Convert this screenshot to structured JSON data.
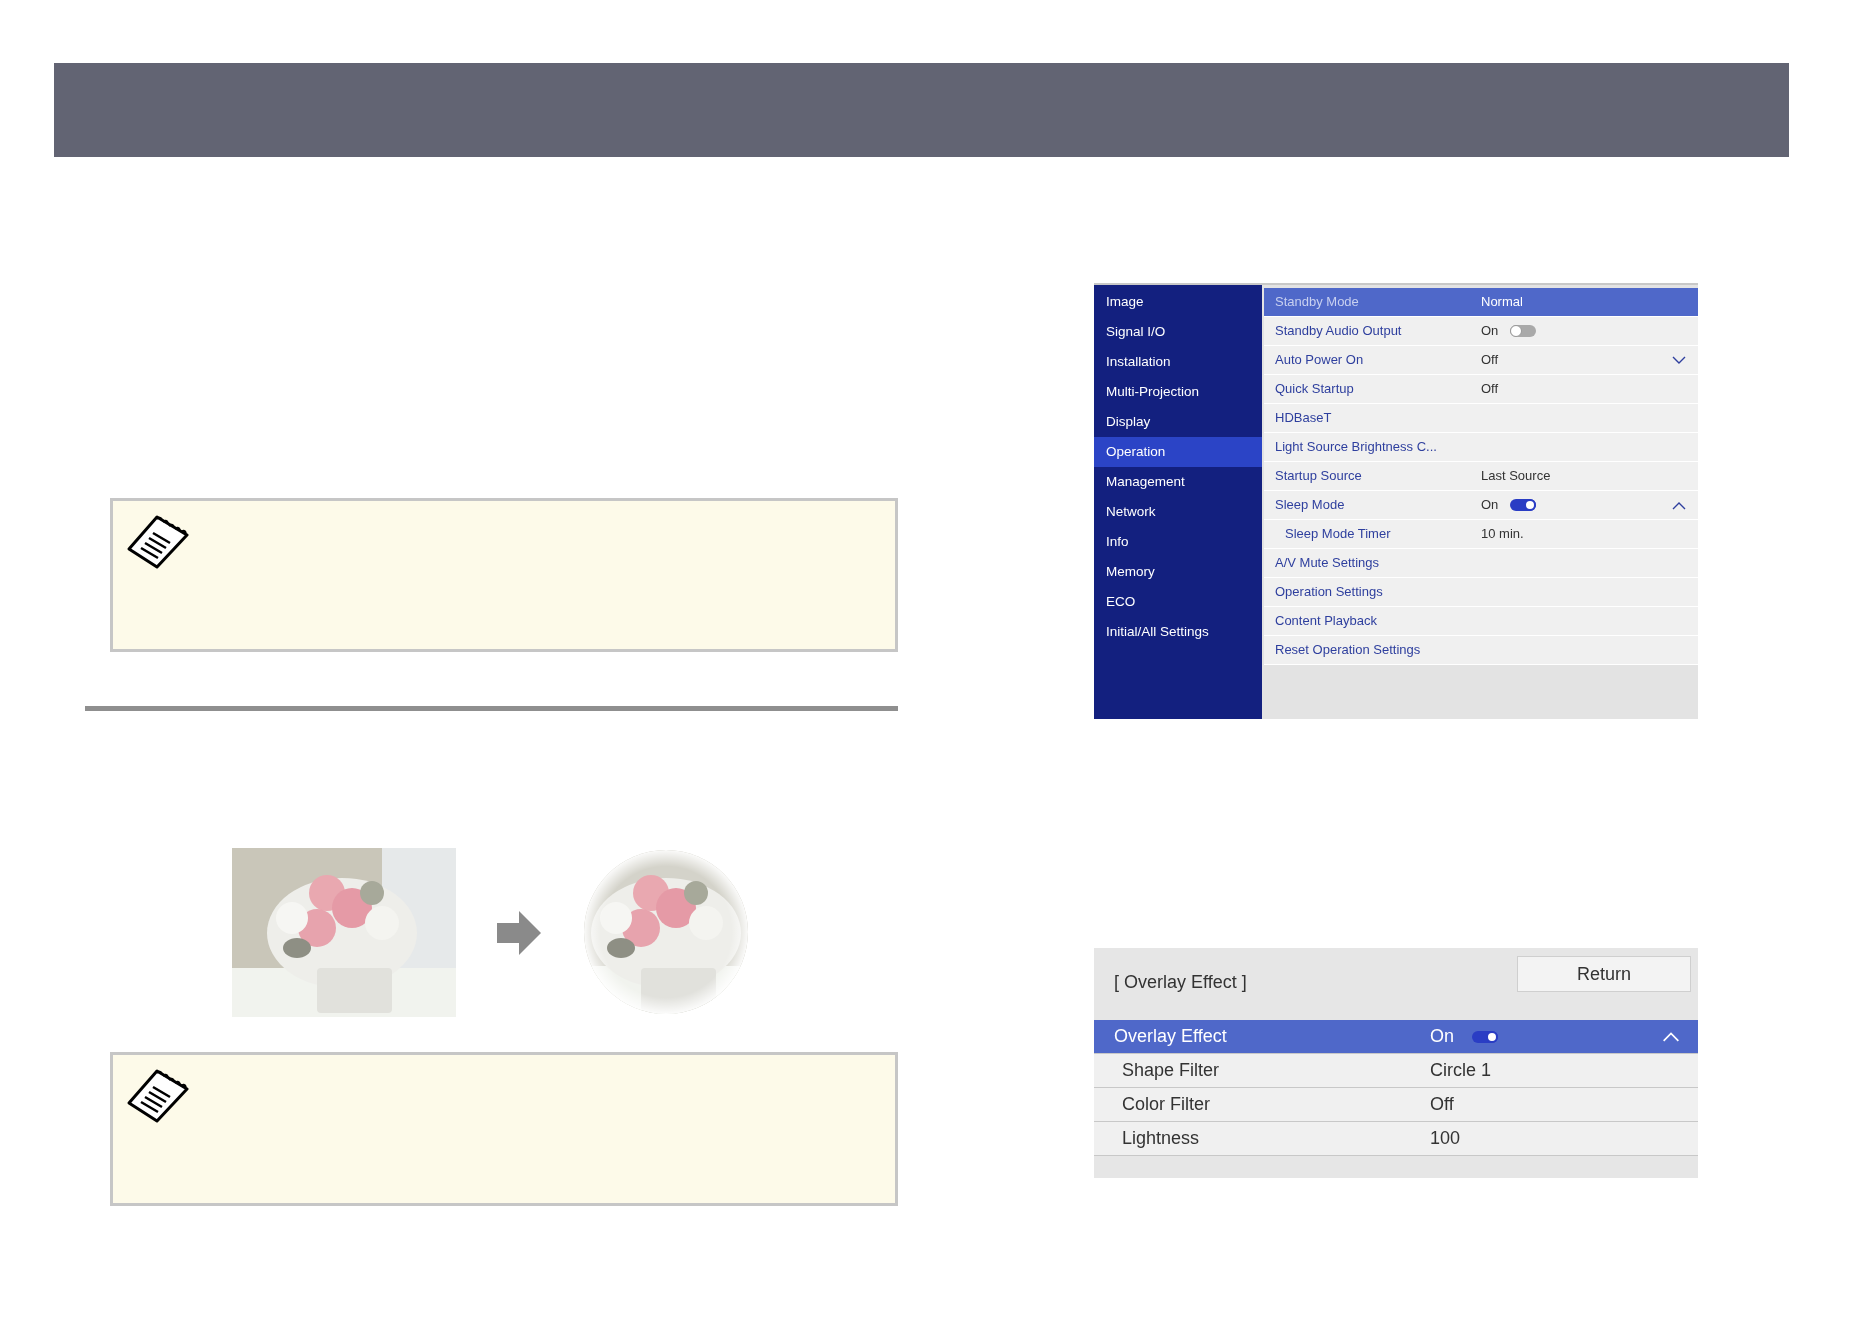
{
  "menu": {
    "categories": [
      {
        "label": "Image",
        "selected": false
      },
      {
        "label": "Signal I/O",
        "selected": false
      },
      {
        "label": "Installation",
        "selected": false
      },
      {
        "label": "Multi-Projection",
        "selected": false
      },
      {
        "label": "Display",
        "selected": false
      },
      {
        "label": "Operation",
        "selected": true
      },
      {
        "label": "Management",
        "selected": false
      },
      {
        "label": "Network",
        "selected": false
      },
      {
        "label": "Info",
        "selected": false
      },
      {
        "label": "Memory",
        "selected": false
      },
      {
        "label": "ECO",
        "selected": false
      },
      {
        "label": "Initial/All Settings",
        "selected": false
      }
    ],
    "rows": [
      {
        "label": "Standby Mode",
        "value": "Normal",
        "selected": true
      },
      {
        "label": "Standby Audio Output",
        "value": "On",
        "kind": "toggle",
        "on": false,
        "selected": false
      },
      {
        "label": "Auto Power On",
        "value": "Off",
        "expanded": false,
        "selected": false
      },
      {
        "label": "Quick Startup",
        "value": "Off",
        "selected": false
      },
      {
        "label": "HDBaseT",
        "selected": false
      },
      {
        "label": "Light Source Brightness C...",
        "selected": false
      },
      {
        "label": "Startup Source",
        "value": "Last Source",
        "selected": false
      },
      {
        "label": "Sleep Mode",
        "value": "On",
        "kind": "toggle",
        "on": true,
        "expanded": true,
        "selected": false,
        "children": [
          {
            "label": "Sleep Mode Timer",
            "value": "10 min.",
            "selected": false
          }
        ]
      },
      {
        "label": "A/V Mute Settings",
        "selected": false
      },
      {
        "label": "Operation Settings",
        "selected": false
      },
      {
        "label": "Content Playback",
        "selected": false
      },
      {
        "label": "Reset Operation Settings",
        "selected": false
      }
    ]
  },
  "overlay_menu": {
    "title": "[ Overlay Effect ]",
    "return_button": "Return",
    "rows": [
      {
        "label": "Overlay Effect",
        "value": "On",
        "kind": "toggle",
        "on": true,
        "expanded": true,
        "selected": true
      },
      {
        "label": "Shape Filter",
        "value": "Circle 1",
        "selected": false
      },
      {
        "label": "Color Filter",
        "value": "Off",
        "selected": false
      },
      {
        "label": "Lightness",
        "value": "100",
        "selected": false
      }
    ]
  }
}
